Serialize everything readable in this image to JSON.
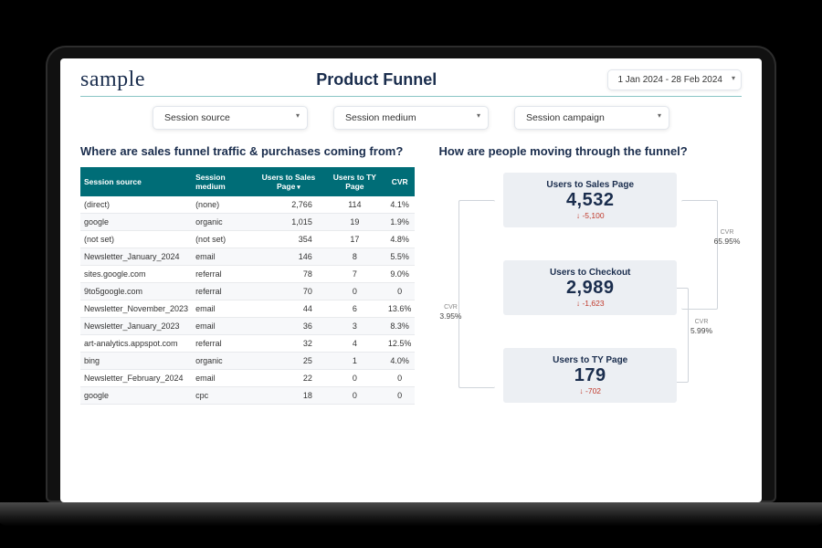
{
  "logo": "sample",
  "title": "Product Funnel",
  "date_range": "1 Jan 2024 - 28 Feb 2024",
  "filters": {
    "source": "Session source",
    "medium": "Session medium",
    "campaign": "Session campaign"
  },
  "left_title": "Where are sales funnel traffic & purchases coming from?",
  "right_title": "How are people moving through the funnel?",
  "table": {
    "headers": {
      "source": "Session source",
      "medium": "Session medium",
      "sales": "Users to Sales Page",
      "ty": "Users to TY Page",
      "cvr": "CVR"
    },
    "rows": [
      {
        "source": "(direct)",
        "medium": "(none)",
        "sales": "2,766",
        "ty": "114",
        "cvr": "4.1%"
      },
      {
        "source": "google",
        "medium": "organic",
        "sales": "1,015",
        "ty": "19",
        "cvr": "1.9%"
      },
      {
        "source": "(not set)",
        "medium": "(not set)",
        "sales": "354",
        "ty": "17",
        "cvr": "4.8%"
      },
      {
        "source": "Newsletter_January_2024",
        "medium": "email",
        "sales": "146",
        "ty": "8",
        "cvr": "5.5%"
      },
      {
        "source": "sites.google.com",
        "medium": "referral",
        "sales": "78",
        "ty": "7",
        "cvr": "9.0%"
      },
      {
        "source": "9to5google.com",
        "medium": "referral",
        "sales": "70",
        "ty": "0",
        "cvr": "0"
      },
      {
        "source": "Newsletter_November_2023",
        "medium": "email",
        "sales": "44",
        "ty": "6",
        "cvr": "13.6%"
      },
      {
        "source": "Newsletter_January_2023",
        "medium": "email",
        "sales": "36",
        "ty": "3",
        "cvr": "8.3%"
      },
      {
        "source": "art-analytics.appspot.com",
        "medium": "referral",
        "sales": "32",
        "ty": "4",
        "cvr": "12.5%"
      },
      {
        "source": "bing",
        "medium": "organic",
        "sales": "25",
        "ty": "1",
        "cvr": "4.0%"
      },
      {
        "source": "Newsletter_February_2024",
        "medium": "email",
        "sales": "22",
        "ty": "0",
        "cvr": "0"
      },
      {
        "source": "google",
        "medium": "cpc",
        "sales": "18",
        "ty": "0",
        "cvr": "0"
      }
    ]
  },
  "funnel": {
    "stages": [
      {
        "label": "Users to Sales Page",
        "value": "4,532",
        "delta": "-5,100"
      },
      {
        "label": "Users to Checkout",
        "value": "2,989",
        "delta": "-1,623"
      },
      {
        "label": "Users to TY Page",
        "value": "179",
        "delta": "-702"
      }
    ],
    "cvr_overall": {
      "label": "CVR",
      "value": "65.95%"
    },
    "cvr_left": {
      "label": "CVR",
      "value": "3.95%"
    },
    "cvr_mid": {
      "label": "CVR",
      "value": "5.99%"
    }
  },
  "chart_data": {
    "type": "table",
    "columns": [
      "Session source",
      "Session medium",
      "Users to Sales Page",
      "Users to TY Page",
      "CVR"
    ],
    "funnel_values": [
      4532,
      2989,
      179
    ],
    "funnel_labels": [
      "Users to Sales Page",
      "Users to Checkout",
      "Users to TY Page"
    ],
    "conversion_rates": {
      "sales_to_checkout": 65.95,
      "checkout_to_ty": 5.99,
      "sales_to_ty": 3.95
    }
  }
}
